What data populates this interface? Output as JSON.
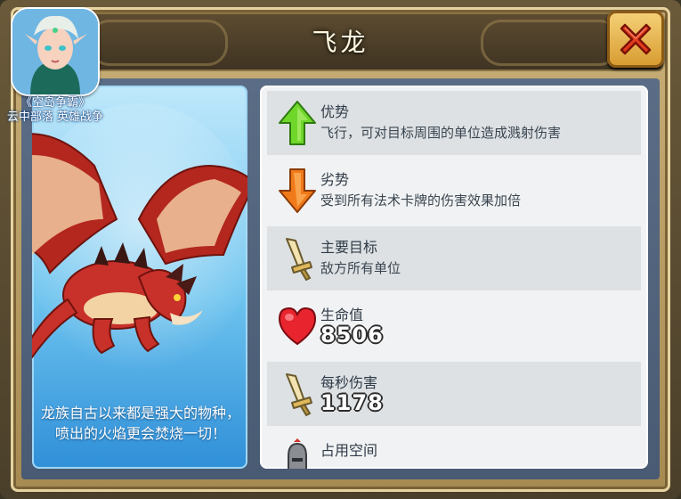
{
  "window": {
    "title": "飞龙",
    "close_label": "✕"
  },
  "watermark": {
    "game_title": "《空岛争霸》",
    "game_subtitle": "云中部落 英雄战争"
  },
  "unit": {
    "description": "龙族自古以来都是强大的物种，喷出的火焰更会焚烧一切！"
  },
  "stats": [
    {
      "label": "优势",
      "text": "飞行，可对目标周围的单位造成溅射伤害",
      "icon": "up-arrow-icon"
    },
    {
      "label": "劣势",
      "text": "受到所有法术卡牌的伤害效果加倍",
      "icon": "down-arrow-icon"
    },
    {
      "label": "主要目标",
      "text": "敌方所有单位",
      "icon": "sword-icon"
    },
    {
      "label": "生命值",
      "value": "8506",
      "icon": "heart-icon"
    },
    {
      "label": "每秒伤害",
      "value": "1178",
      "icon": "sword-icon"
    },
    {
      "label": "占用空间",
      "value": "",
      "icon": "soldier-icon"
    }
  ],
  "colors": {
    "close_button": "#e33b1f",
    "up_arrow": "#6fd62a",
    "down_arrow": "#f07a1a",
    "heart": "#e8252f",
    "sword": "#f2d98a"
  }
}
